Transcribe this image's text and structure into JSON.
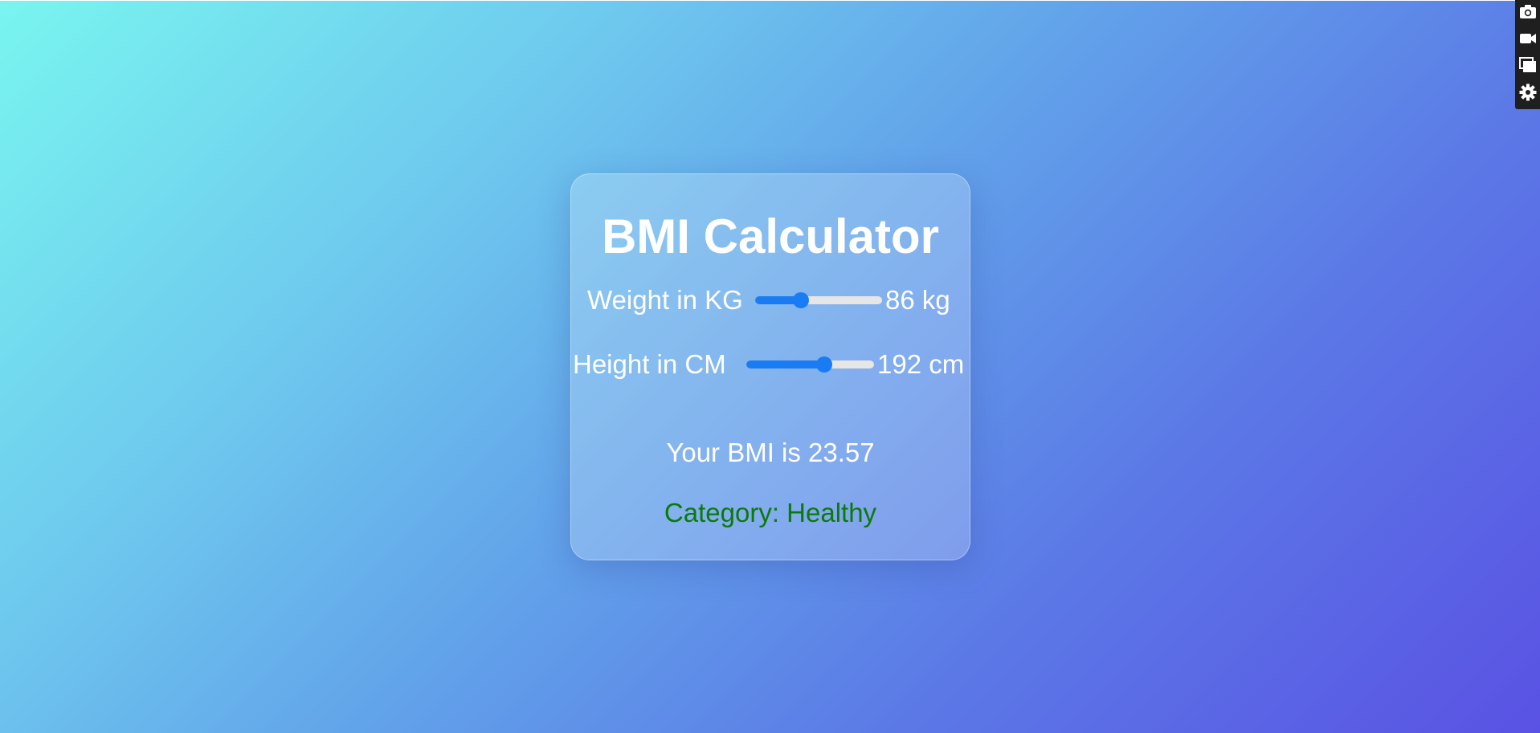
{
  "app": {
    "title": "BMI Calculator"
  },
  "weight": {
    "label": "Weight in KG",
    "value_text": "86 kg",
    "slider_fraction": 0.36
  },
  "height": {
    "label": "Height in CM",
    "value_text": "192 cm",
    "slider_fraction": 0.61
  },
  "result": {
    "bmi_text": "Your BMI is 23.57",
    "category_text": "Category: Healthy"
  },
  "toolbar": {
    "icons": [
      "camera-icon",
      "video-camera-icon",
      "windows-icon",
      "gear-icon"
    ]
  },
  "colors": {
    "accent": "#1a7cf2",
    "category": "#0a7a0a",
    "toolbar_bg": "#1f1f1f"
  }
}
